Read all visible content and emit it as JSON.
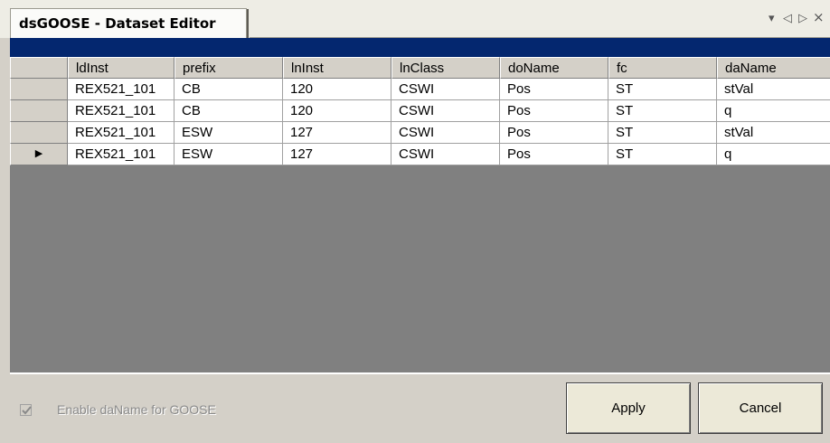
{
  "tab": {
    "title": "dsGOOSE - Dataset Editor"
  },
  "tab_controls": {
    "dropdown": "▾",
    "prev": "◁",
    "next": "▷",
    "close": "×"
  },
  "grid": {
    "columns": [
      "ldInst",
      "prefix",
      "lnInst",
      "lnClass",
      "doName",
      "fc",
      "daName"
    ],
    "rows": [
      [
        "REX521_101",
        "CB",
        "120",
        "CSWI",
        "Pos",
        "ST",
        "stVal"
      ],
      [
        "REX521_101",
        "CB",
        "120",
        "CSWI",
        "Pos",
        "ST",
        "q"
      ],
      [
        "REX521_101",
        "ESW",
        "127",
        "CSWI",
        "Pos",
        "ST",
        "stVal"
      ],
      [
        "REX521_101",
        "ESW",
        "127",
        "CSWI",
        "Pos",
        "ST",
        "q"
      ]
    ],
    "current_row_marker": "▶",
    "current_row_index": 3
  },
  "options": {
    "enable_daname_label": "Enable daName for GOOSE",
    "enable_daname_checked": true,
    "enable_daname_enabled": false
  },
  "buttons": {
    "apply": "Apply",
    "cancel": "Cancel"
  },
  "colors": {
    "caption": "#04276f",
    "grid_empty": "#808080",
    "panel": "#d4d0c8"
  }
}
